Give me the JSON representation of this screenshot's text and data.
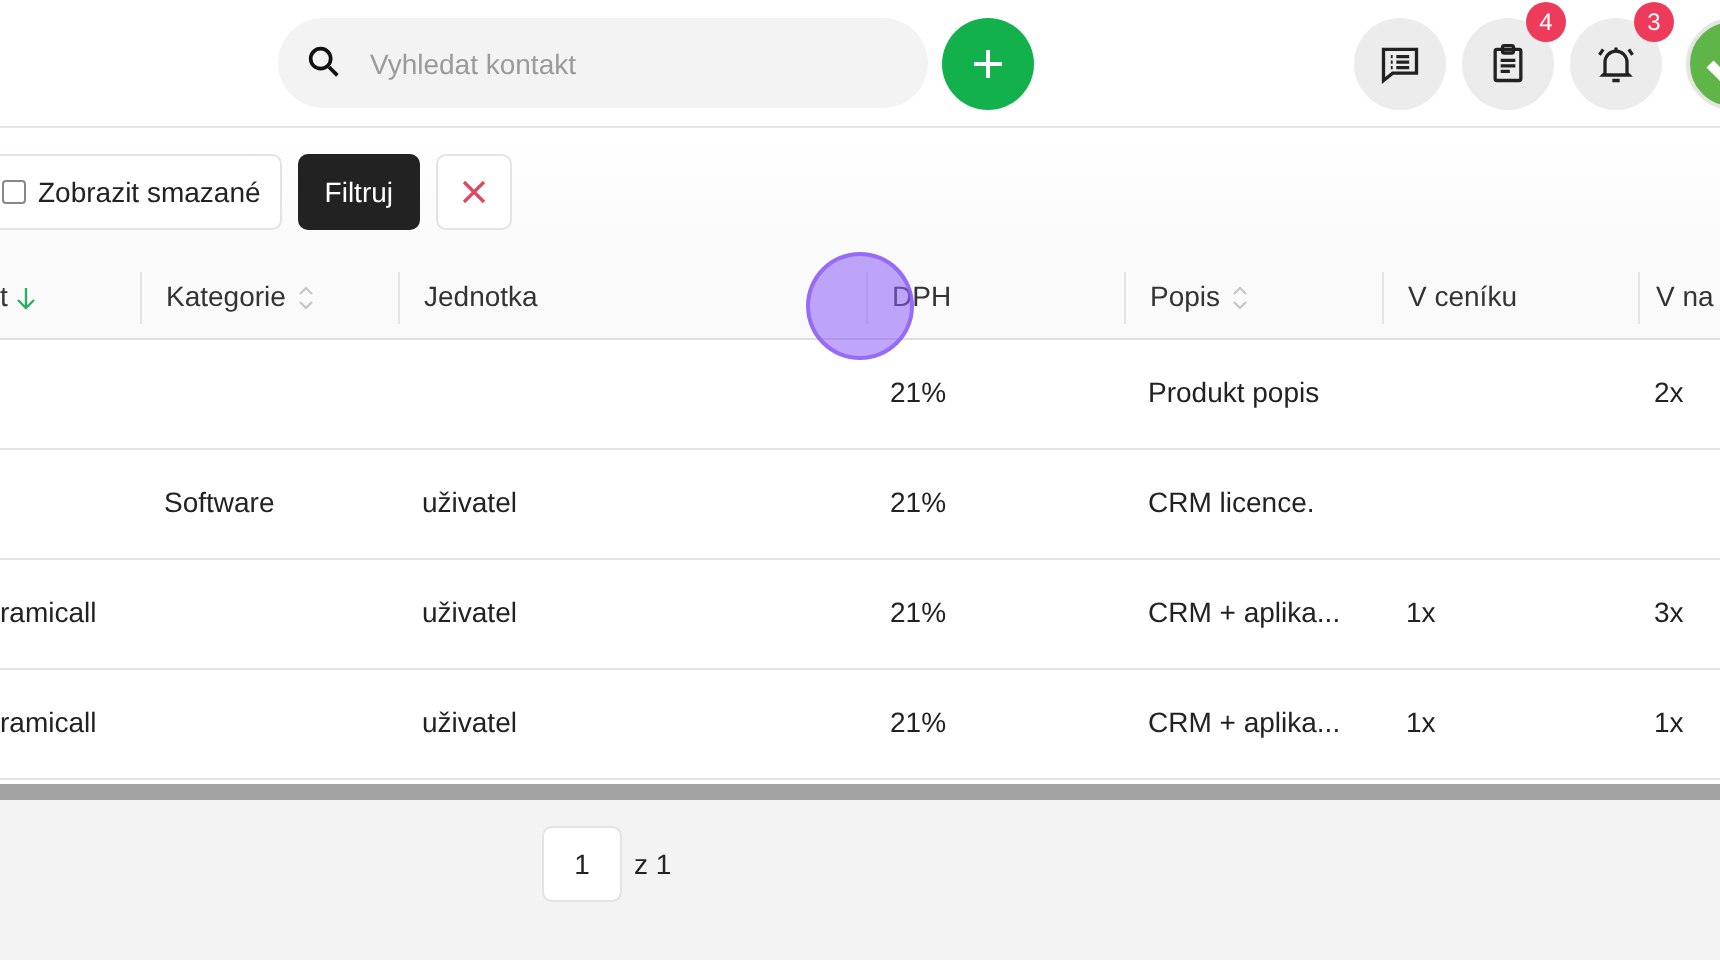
{
  "search": {
    "placeholder": "Vyhledat kontakt"
  },
  "header_icons": [
    {
      "kind": "messages"
    },
    {
      "kind": "clipboard",
      "badge": "4"
    },
    {
      "kind": "alarm",
      "badge": "3"
    }
  ],
  "filters": {
    "show_deleted": {
      "label": "Zobrazit smazané",
      "checked": false
    },
    "filter_button": "Filtruj"
  },
  "table": {
    "columns": [
      {
        "label": "t",
        "sorted_descending": true
      },
      {
        "label": "Kategorie",
        "sortable": true
      },
      {
        "label": "Jednotka"
      },
      {
        "label": "DPH"
      },
      {
        "label": "Popis",
        "sortable": true
      },
      {
        "label": "V ceníku"
      },
      {
        "label": "V na"
      }
    ],
    "rows": [
      [
        "",
        "",
        "",
        "21%",
        "Produkt popis",
        "",
        "2x"
      ],
      [
        "",
        "Software",
        "uživatel",
        "21%",
        "CRM licence.",
        "",
        ""
      ],
      [
        "ramicall",
        "",
        "uživatel",
        "21%",
        "CRM + aplika...",
        "1x",
        "3x"
      ],
      [
        "ramicall",
        "",
        "uživatel",
        "21%",
        "CRM + aplika...",
        "1x",
        "1x"
      ]
    ]
  },
  "pagination": {
    "page": "1",
    "total": "z 1"
  }
}
